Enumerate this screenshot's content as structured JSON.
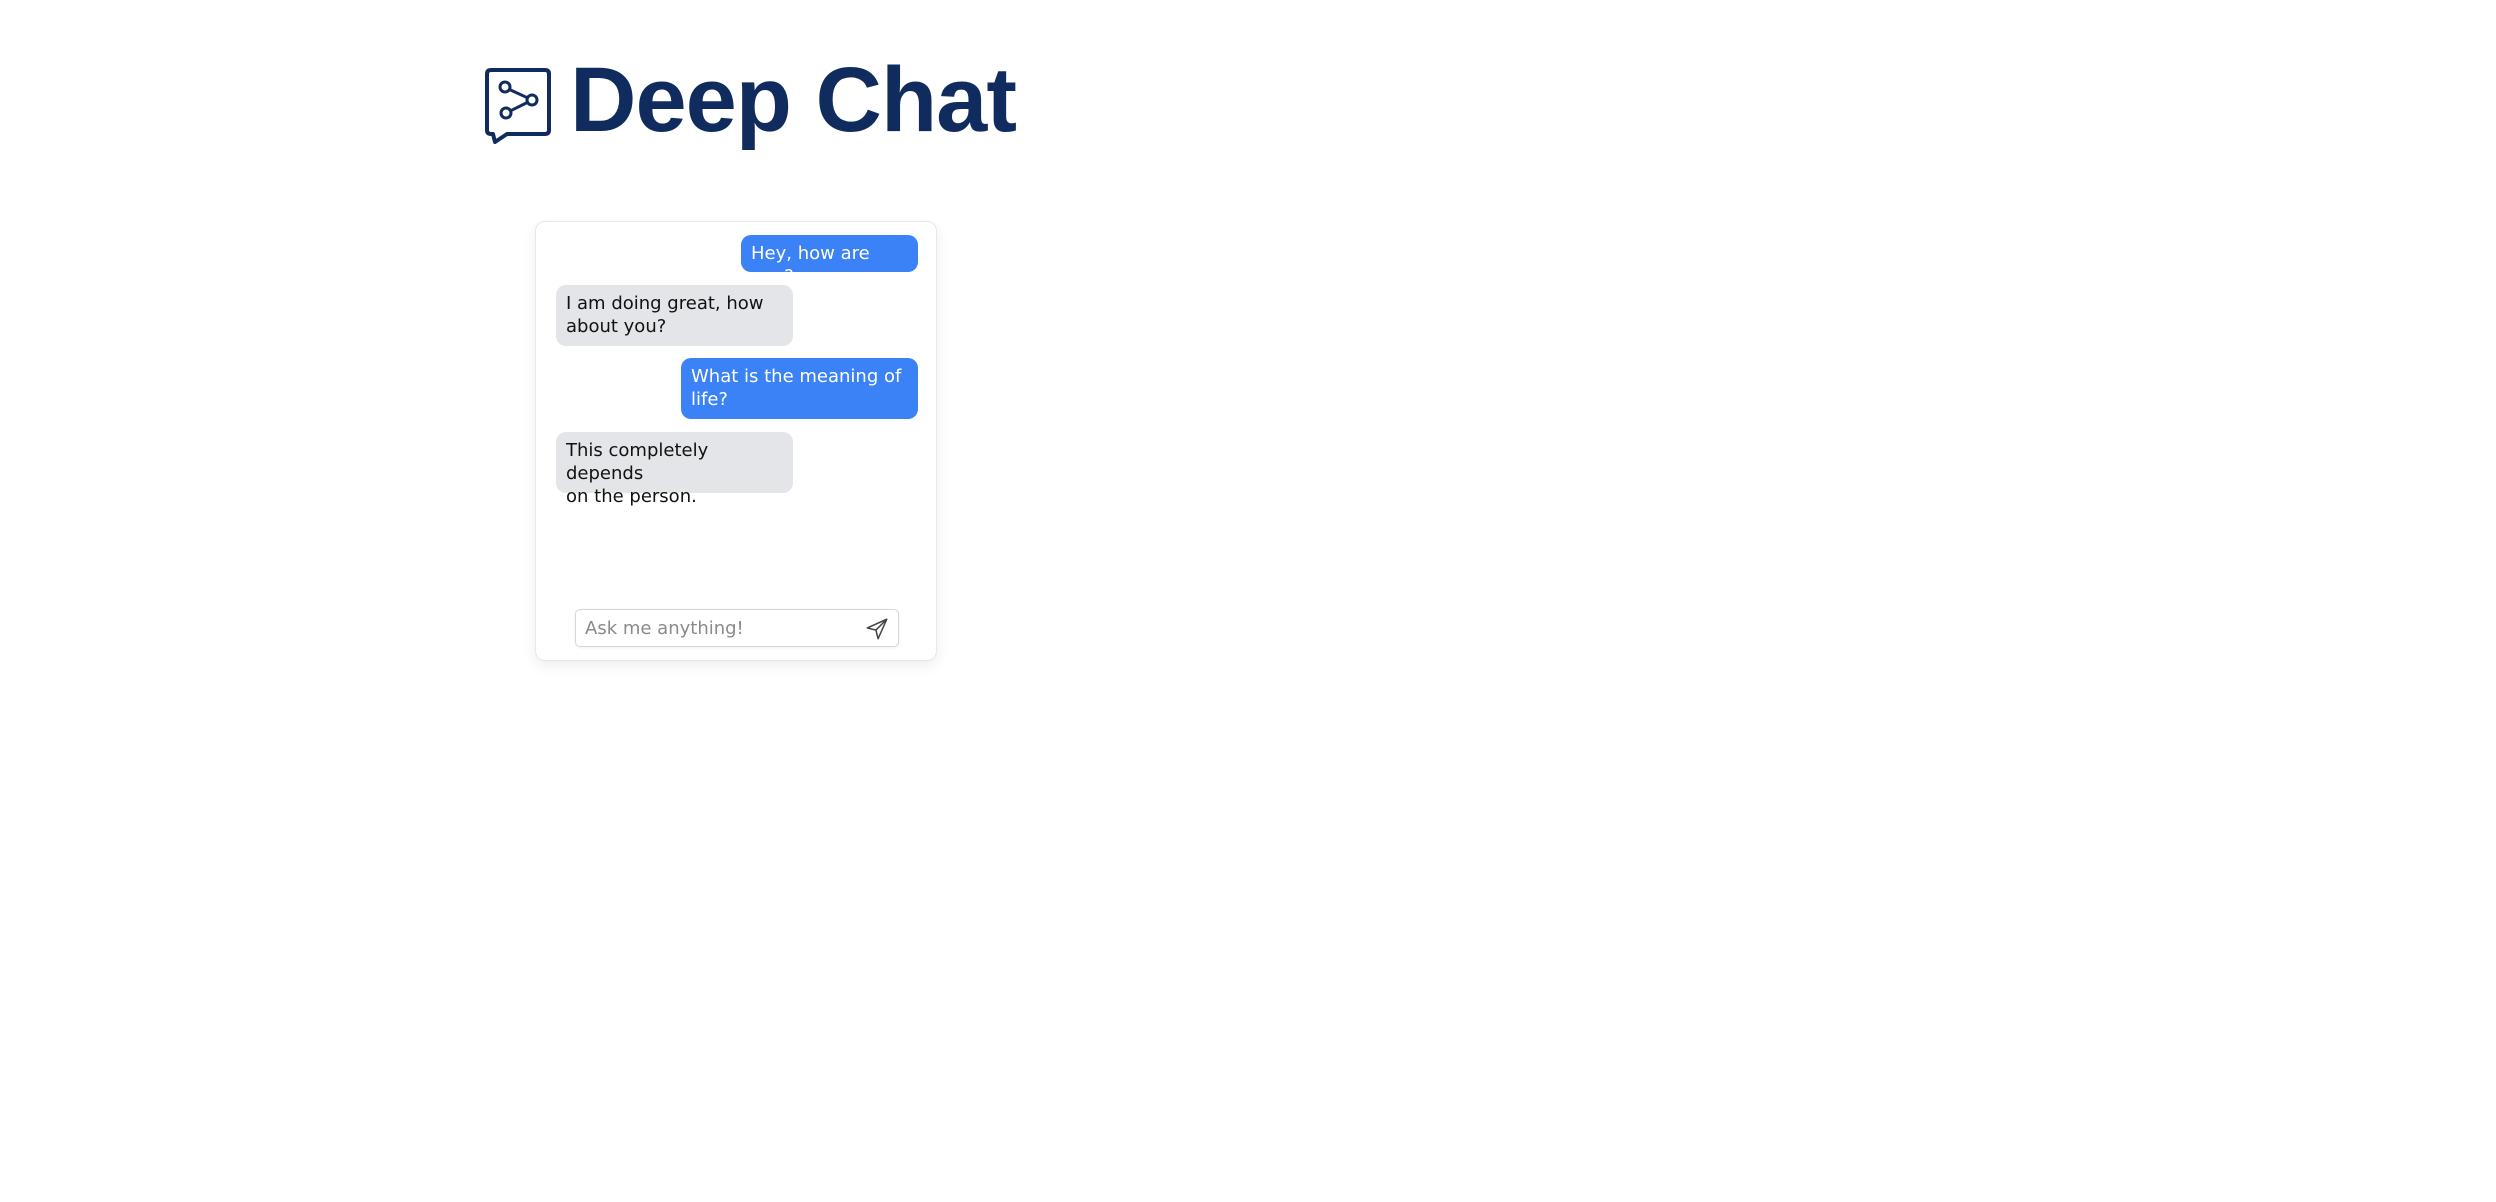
{
  "header": {
    "title": "Deep Chat",
    "logo_icon": "chat-bubble-share-icon",
    "title_color": "#102c5e"
  },
  "chat": {
    "messages": [
      {
        "role": "user",
        "text": "Hey, how are you?"
      },
      {
        "role": "ai",
        "text": "I am doing great, how\nabout you?"
      },
      {
        "role": "user",
        "text": "What is the meaning of\nlife?"
      },
      {
        "role": "ai",
        "text": "This completely depends\non the person."
      }
    ],
    "input": {
      "value": "",
      "placeholder": "Ask me anything!"
    },
    "send_icon": "send-icon",
    "user_bubble_color": "#3b82f6",
    "ai_bubble_color": "#e4e5e8"
  }
}
